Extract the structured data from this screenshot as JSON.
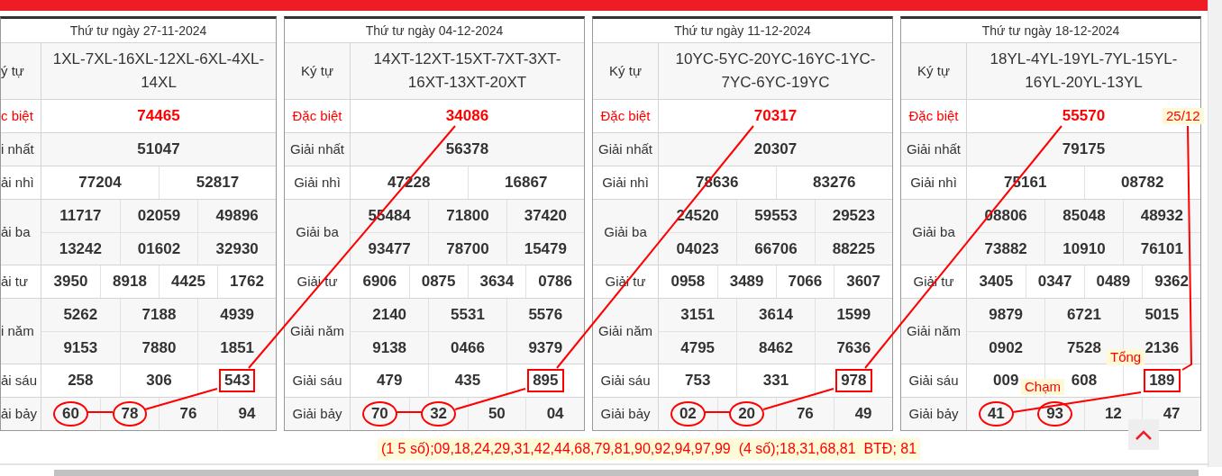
{
  "tables": [
    {
      "date": "Thứ tư ngày 27-11-2024",
      "code_label": "ý tự",
      "code": "1XL-7XL-16XL-12XL-6XL-4XL-14XL",
      "prizes": [
        {
          "kind": "special",
          "label": "c biệt",
          "numbers": [
            "74465"
          ]
        },
        {
          "kind": "regular",
          "label": "i nhất",
          "numbers": [
            "51047"
          ]
        },
        {
          "kind": "regular",
          "label": "ải nhì",
          "numbers": [
            "77204",
            "52817"
          ]
        },
        {
          "kind": "regular",
          "label": "ải ba",
          "numbers": [
            "11717",
            "02059",
            "49896",
            "13242",
            "01602",
            "32930"
          ]
        },
        {
          "kind": "regular",
          "label": "ải tư",
          "numbers": [
            "3950",
            "8918",
            "4425",
            "1762"
          ]
        },
        {
          "kind": "regular",
          "label": "i năm",
          "numbers": [
            "5262",
            "7188",
            "4939",
            "9153",
            "7880",
            "1851"
          ]
        },
        {
          "kind": "regular",
          "label": "ải sáu",
          "numbers": [
            "258",
            "306",
            "543"
          ],
          "boxed": [
            false,
            false,
            true
          ]
        },
        {
          "kind": "regular",
          "label": "ải bảy",
          "numbers": [
            "60",
            "78",
            "76",
            "94"
          ],
          "circled": [
            true,
            true,
            false,
            false
          ]
        }
      ]
    },
    {
      "date": "Thứ tư ngày 04-12-2024",
      "code_label": "Ký tự",
      "code": "14XT-12XT-15XT-7XT-3XT-16XT-13XT-20XT",
      "prizes": [
        {
          "kind": "special",
          "label": "Đặc biệt",
          "numbers": [
            "34086"
          ]
        },
        {
          "kind": "regular",
          "label": "Giải nhất",
          "numbers": [
            "56378"
          ]
        },
        {
          "kind": "regular",
          "label": "Giải nhì",
          "numbers": [
            "47228",
            "16867"
          ]
        },
        {
          "kind": "regular",
          "label": "Giải ba",
          "numbers": [
            "55484",
            "71800",
            "37420",
            "93477",
            "78700",
            "15479"
          ]
        },
        {
          "kind": "regular",
          "label": "Giải tư",
          "numbers": [
            "6906",
            "0875",
            "3634",
            "0786"
          ]
        },
        {
          "kind": "regular",
          "label": "Giải năm",
          "numbers": [
            "2140",
            "5531",
            "5576",
            "9138",
            "0466",
            "9379"
          ]
        },
        {
          "kind": "regular",
          "label": "Giải sáu",
          "numbers": [
            "479",
            "435",
            "895"
          ],
          "boxed": [
            false,
            false,
            true
          ]
        },
        {
          "kind": "regular",
          "label": "Giải bảy",
          "numbers": [
            "70",
            "32",
            "50",
            "04"
          ],
          "circled": [
            true,
            true,
            false,
            false
          ]
        }
      ]
    },
    {
      "date": "Thứ tư ngày 11-12-2024",
      "code_label": "Ký tự",
      "code": "10YC-5YC-20YC-16YC-1YC-7YC-6YC-19YC",
      "prizes": [
        {
          "kind": "special",
          "label": "Đặc biệt",
          "numbers": [
            "70317"
          ]
        },
        {
          "kind": "regular",
          "label": "Giải nhất",
          "numbers": [
            "20307"
          ]
        },
        {
          "kind": "regular",
          "label": "Giải nhì",
          "numbers": [
            "78636",
            "83276"
          ]
        },
        {
          "kind": "regular",
          "label": "Giải ba",
          "numbers": [
            "24520",
            "59553",
            "29523",
            "04023",
            "66706",
            "88225"
          ]
        },
        {
          "kind": "regular",
          "label": "Giải tư",
          "numbers": [
            "0958",
            "3489",
            "7066",
            "3607"
          ]
        },
        {
          "kind": "regular",
          "label": "Giải năm",
          "numbers": [
            "3151",
            "3614",
            "1599",
            "4795",
            "8462",
            "7636"
          ]
        },
        {
          "kind": "regular",
          "label": "Giải sáu",
          "numbers": [
            "753",
            "331",
            "978"
          ],
          "boxed": [
            false,
            false,
            true
          ]
        },
        {
          "kind": "regular",
          "label": "Giải bảy",
          "numbers": [
            "02",
            "20",
            "76",
            "49"
          ],
          "circled": [
            true,
            true,
            false,
            false
          ]
        }
      ]
    },
    {
      "date": "Thứ tư ngày 18-12-2024",
      "code_label": "Ký tự",
      "code": "18YL-4YL-19YL-7YL-15YL-16YL-20YL-13YL",
      "prizes": [
        {
          "kind": "special",
          "label": "Đặc biệt",
          "numbers": [
            "55570"
          ]
        },
        {
          "kind": "regular",
          "label": "Giải nhất",
          "numbers": [
            "79175"
          ]
        },
        {
          "kind": "regular",
          "label": "Giải nhì",
          "numbers": [
            "75161",
            "08782"
          ]
        },
        {
          "kind": "regular",
          "label": "Giải ba",
          "numbers": [
            "08806",
            "85048",
            "48932",
            "73882",
            "10910",
            "76101"
          ]
        },
        {
          "kind": "regular",
          "label": "Giải tư",
          "numbers": [
            "3405",
            "0347",
            "0489",
            "9362"
          ]
        },
        {
          "kind": "regular",
          "label": "Giải năm",
          "numbers": [
            "9879",
            "6721",
            "5015",
            "0902",
            "7528",
            "2136"
          ]
        },
        {
          "kind": "regular",
          "label": "Giải sáu",
          "numbers": [
            "009",
            "608",
            "189"
          ],
          "boxed": [
            false,
            false,
            true
          ]
        },
        {
          "kind": "regular",
          "label": "Giải bảy",
          "numbers": [
            "41",
            "93",
            "12",
            "47"
          ],
          "circled": [
            true,
            true,
            false,
            false
          ]
        }
      ]
    }
  ],
  "annotations": [
    "25/12",
    "Tổng",
    "Chạm"
  ],
  "summary": "(1 5 số);09,18,24,29,31,42,44,68,79,81,90,92,94,97,99  (4 số);18,31,68,81  BTĐ; 81"
}
